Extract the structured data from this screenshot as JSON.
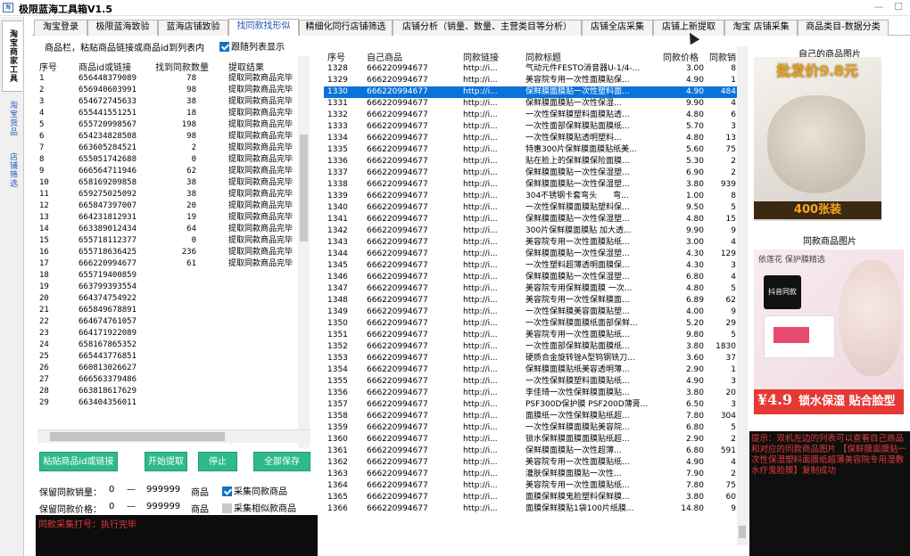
{
  "app": {
    "title": "极限蓝海工具箱V1.5",
    "icon_text": "淘"
  },
  "window": {
    "minimize_glyph": "—",
    "maximize_glyph": "☐"
  },
  "vtabs": [
    "淘宝商家工具",
    "淘宝货品",
    "店铺筛选"
  ],
  "tabs": [
    "淘宝登录",
    "极限蓝海致验",
    "蓝海店铺致验",
    "找同款找形似",
    "精细化同行店铺筛选",
    "店铺分析（销量、数量、主营类目等分析）",
    "店铺全店采集",
    "店铺上新提取",
    "淘宝 店铺采集",
    "商品类目-数据分类"
  ],
  "left": {
    "product_label": "商品栏，粘贴商品链接或商品id到列表内",
    "follow_label": "跟随列表显示",
    "headers": [
      "序号",
      "商品id或链接",
      "找到同款数量",
      "提取结果"
    ],
    "rows": [
      [
        "1",
        "656448379089",
        "78",
        "提取同款商品完毕"
      ],
      [
        "2",
        "656940603991",
        "98",
        "提取同款商品完毕"
      ],
      [
        "3",
        "654672745633",
        "38",
        "提取同款商品完毕"
      ],
      [
        "4",
        "655441551251",
        "18",
        "提取同款商品完毕"
      ],
      [
        "5",
        "655720998567",
        "198",
        "提取同款商品完毕"
      ],
      [
        "6",
        "654234828508",
        "98",
        "提取同款商品完毕"
      ],
      [
        "7",
        "663605284521",
        "2",
        "提取同款商品完毕"
      ],
      [
        "8",
        "655051742688",
        "0",
        "提取同款商品完毕"
      ],
      [
        "9",
        "666564711946",
        "62",
        "提取同款商品完毕"
      ],
      [
        "10",
        "658169209858",
        "38",
        "提取同款商品完毕"
      ],
      [
        "11",
        "659275025092",
        "38",
        "提取同款商品完毕"
      ],
      [
        "12",
        "665847397007",
        "20",
        "提取同款商品完毕"
      ],
      [
        "13",
        "664231812931",
        "19",
        "提取同款商品完毕"
      ],
      [
        "14",
        "663389012434",
        "64",
        "提取同款商品完毕"
      ],
      [
        "15",
        "655718112377",
        "0",
        "提取同款商品完毕"
      ],
      [
        "16",
        "655718636425",
        "236",
        "提取同款商品完毕"
      ],
      [
        "17",
        "666220994677",
        "61",
        "提取同款商品完毕"
      ],
      [
        "18",
        "655719400859",
        "",
        ""
      ],
      [
        "19",
        "663799393554",
        "",
        ""
      ],
      [
        "20",
        "664374754922",
        "",
        ""
      ],
      [
        "21",
        "665849678891",
        "",
        ""
      ],
      [
        "22",
        "664674761057",
        "",
        ""
      ],
      [
        "23",
        "664171922089",
        "",
        ""
      ],
      [
        "24",
        "658167865352",
        "",
        ""
      ],
      [
        "25",
        "665443776851",
        "",
        ""
      ],
      [
        "26",
        "660813026627",
        "",
        ""
      ],
      [
        "27",
        "666563379486",
        "",
        ""
      ],
      [
        "28",
        "663818617629",
        "",
        ""
      ],
      [
        "29",
        "663404356011",
        "",
        ""
      ]
    ],
    "buttons": {
      "paste": "粘贴商品id或链接",
      "start": "开始提取",
      "stop": "停止",
      "save": "全部保存"
    },
    "filters": {
      "sales_label": "保留同款销量：",
      "sales_min": "0",
      "sales_sep": "—",
      "sales_max": "999999",
      "sales_unit": "商品",
      "sales_check": "采集同款商品",
      "price_label": "保留同款价格：",
      "price_min": "0",
      "price_sep": "—",
      "price_max": "999999",
      "price_unit": "商品",
      "price_check": "采集相似款商品"
    },
    "log": "同款采集打号：执行完毕"
  },
  "right": {
    "headers": [
      "序号",
      "自己商品",
      "同款链接",
      "同款标题",
      "同款价格",
      "同款销"
    ],
    "link": "http://i...",
    "own": "666220994677",
    "selected_index": 2,
    "rows": [
      [
        "1328",
        "气动元件FESTO消音器U-1/4-...",
        "3.00",
        "8"
      ],
      [
        "1329",
        "美容院专用一次性面膜贴保...",
        "4.90",
        "1"
      ],
      [
        "1330",
        "保鲜膜面膜贴一次性塑料面...",
        "4.90",
        "484"
      ],
      [
        "1331",
        "保鲜膜面膜贴一次性保湿...",
        "9.90",
        "4"
      ],
      [
        "1332",
        "一次性保鲜膜塑料面膜贴透...",
        "4.80",
        "6"
      ],
      [
        "1333",
        "一次性面部保鲜膜贴面膜纸...",
        "5.70",
        "3"
      ],
      [
        "1334",
        "一次性保鲜膜贴透明塑料...",
        "4.80",
        "13"
      ],
      [
        "1335",
        "特惠300片保鲜膜面膜贴纸美...",
        "5.60",
        "75"
      ],
      [
        "1336",
        "贴在脸上的保鲜膜保险面膜...",
        "5.30",
        "2"
      ],
      [
        "1337",
        "保鲜膜面膜贴一次性保湿塑...",
        "6.90",
        "2"
      ],
      [
        "1338",
        "保鲜膜面膜贴一次性保湿塑...",
        "3.80",
        "939"
      ],
      [
        "1339",
        "304不锈钢卡套弯头　　弯...",
        "1.00",
        "8"
      ],
      [
        "1340",
        "一次性保鲜膜面膜贴塑料保...",
        "9.50",
        "5"
      ],
      [
        "1341",
        "保鲜膜面膜贴一次性保湿塑...",
        "4.80",
        "15"
      ],
      [
        "1342",
        "300片保鲜膜面膜贴 加大透...",
        "9.90",
        "9"
      ],
      [
        "1343",
        "美容院专用一次性面膜贴纸...",
        "3.00",
        "4"
      ],
      [
        "1344",
        "保鲜膜面膜贴一次性保湿塑...",
        "4.30",
        "129"
      ],
      [
        "1345",
        "一次性塑料超薄透明面膜保...",
        "4.30",
        "3"
      ],
      [
        "1346",
        "保鲜膜面膜贴一次性保湿塑...",
        "6.80",
        "4"
      ],
      [
        "1347",
        "美容院专用保鲜膜面膜 一次...",
        "4.80",
        "5"
      ],
      [
        "1348",
        "美容院专用一次性保鲜膜面...",
        "6.89",
        "62"
      ],
      [
        "1349",
        "一次性保鲜膜美容面膜贴塑...",
        "4.00",
        "9"
      ],
      [
        "1350",
        "一次性保鲜膜面膜纸面部保鲜...",
        "5.20",
        "29"
      ],
      [
        "1351",
        "美容院专用一次性面膜贴纸...",
        "9.80",
        "5"
      ],
      [
        "1352",
        "一次性面部保鲜膜贴面膜纸...",
        "3.80",
        "1830"
      ],
      [
        "1353",
        "硬质合金旋转锉A型钨钢铣刀...",
        "3.60",
        "37"
      ],
      [
        "1354",
        "保鲜膜面膜贴纸美容透明薄...",
        "2.90",
        "1"
      ],
      [
        "1355",
        "一次性保鲜膜塑料面膜贴纸...",
        "4.90",
        "3"
      ],
      [
        "1356",
        "李佳琦一次性保鲜膜面膜贴...",
        "3.80",
        "20"
      ],
      [
        "1357",
        "PSF300D保护膜 PSF200D薄膏...",
        "6.50",
        "3"
      ],
      [
        "1358",
        "面膜纸一次性保鲜膜贴纸超...",
        "7.80",
        "304"
      ],
      [
        "1359",
        "一次性保鲜膜面膜贴美容院...",
        "6.80",
        "5"
      ],
      [
        "1360",
        "锁水保鲜膜面膜面膜贴纸超...",
        "2.90",
        "2"
      ],
      [
        "1361",
        "保鲜膜面膜贴一次性超薄...",
        "6.80",
        "591"
      ],
      [
        "1362",
        "美容院专用一次性面膜贴纸...",
        "4.90",
        "4"
      ],
      [
        "1363",
        "灌肤保鲜膜面膜贴一次性...",
        "7.90",
        "2"
      ],
      [
        "1364",
        "美容院专用一次性面膜贴纸...",
        "7.80",
        "75"
      ],
      [
        "1365",
        "面膜保鲜膜鬼脸塑料保鲜膜...",
        "3.80",
        "60"
      ],
      [
        "1366",
        "面膜保鲜膜贴1袋100片纸膜...",
        "14.80",
        "9"
      ]
    ]
  },
  "side": {
    "own_caption": "自己的商品图片",
    "own_banner": "批发价9.8元",
    "own_footer": "400张装",
    "same_caption": "同款商品图片",
    "same_brand": "依莲花 保护膜精选",
    "same_tiktok": "抖音同款",
    "same_price": "¥4.9",
    "same_slogan": "锁水保湿 贴合脸型",
    "tips": "提示：双机左边的列表可以查看自己商品和对应的同款商品图片\n【保鲜膜面膜贴一次性保湿塑料面膜纸超薄美容院专用湿敷水疗鬼脸膜】复制成功"
  }
}
